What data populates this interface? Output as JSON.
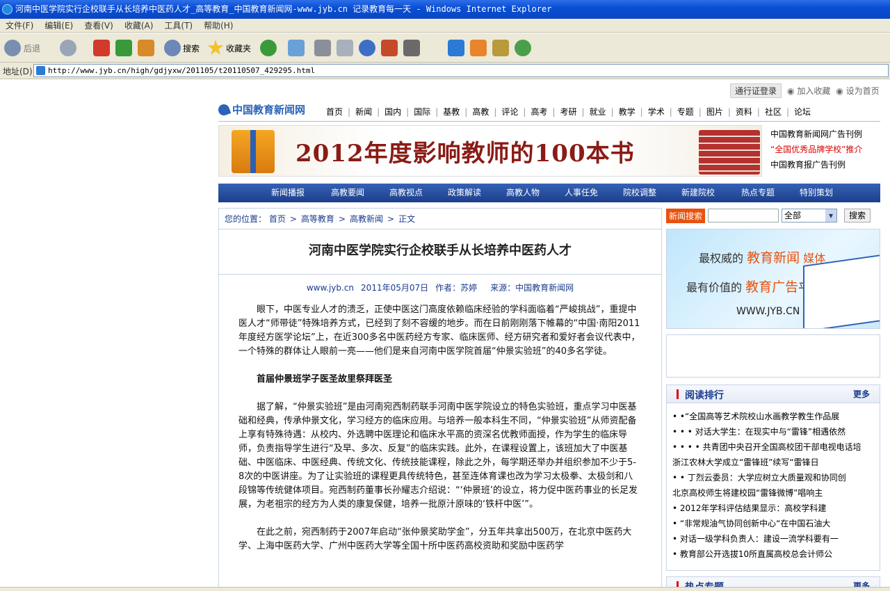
{
  "window": {
    "title": "河南中医学院实行企校联手从长培养中医药人才_高等教育_中国教育新闻网-www.jyb.cn 记录教育每一天 - Windows Internet Explorer"
  },
  "menu": [
    "文件(F)",
    "编辑(E)",
    "查看(V)",
    "收藏(A)",
    "工具(T)",
    "帮助(H)"
  ],
  "toolbar": {
    "back": "后退",
    "search": "搜索",
    "favorites": "收藏夹"
  },
  "address": {
    "label": "地址(D)",
    "url": "http://www.jyb.cn/high/gdjyxw/201105/t20110507_429295.html"
  },
  "site": {
    "login": "通行证登录",
    "add_fav": "加入收藏",
    "set_home": "设为首页",
    "logo": "中国教育新闻网",
    "nav": [
      "首页",
      "新闻",
      "国内",
      "国际",
      "基教",
      "高教",
      "评论",
      "高考",
      "考研",
      "就业",
      "教学",
      "学术",
      "专题",
      "图片",
      "资料",
      "社区",
      "论坛"
    ],
    "banner_text": "2012年度影响教师的100本书",
    "ad_links": [
      "中国教育新闻网广告刊例",
      "“全国优秀品牌学校”推介",
      "中国教育报广告刊例"
    ],
    "subnav": [
      "新闻播报",
      "高教要闻",
      "高教视点",
      "政策解读",
      "高教人物",
      "人事任免",
      "院校调整",
      "新建院校",
      "热点专题",
      "特别策划"
    ]
  },
  "article": {
    "crumb_label": "您的位置：",
    "crumbs": [
      "首页",
      "高等教育",
      "高教新闻",
      "正文"
    ],
    "title": "河南中医学院实行企校联手从长培养中医药人才",
    "meta": {
      "site": "www.jyb.cn",
      "date": "2011年05月07日",
      "author": "作者：苏婷",
      "source": "来源：中国教育新闻网"
    },
    "paragraphs": [
      "眼下，中医专业人才的溃乏，正使中医这门高度依赖临床经验的学科面临着“严峻挑战”，重提中医人才“师带徒”特殊培养方式，已经到了刻不容缓的地步。而在日前刚刚落下帷幕的“中国·南阳2011年度经方医学论坛”上，在近300多名中医药经方专家、临床医师、经方研究者和爱好者会议代表中，一个特殊的群体让人眼前一亮——他们是来自河南中医学院首届“仲景实验班”的40多名学徒。",
      "首届仲景班学子医圣故里祭拜医圣",
      "据了解，“仲景实验班”是由河南宛西制药联手河南中医学院设立的特色实验班，重点学习中医基础和经典，传承仲景文化，学习经方的临床应用。与培养一般本科生不同，“仲景实验班”从师资配备上享有特殊待遇：从校内、外选聘中医理论和临床水平高的资深名优教师面授，作为学生的临床导师，负责指导学生进行“及早、多次、反复”的临床实践。此外，在课程设置上，该班加大了中医基础、中医临床、中医经典、传统文化、传统技能课程，除此之外，每学期还举办并组织参加不少于5-8次的中医讲座。为了让实验班的课程更具传统特色，甚至连体育课也改为学习太极拳、太极剑和八段锦等传统健体项目。宛西制药董事长孙耀志介绍说：“‘仲景班’的设立，将力促中医药事业的长足发展，为老祖宗的经方为人类的康复保健，培养一批原汁原味的‘铁杆中医’”。",
      "在此之前，宛西制药于2007年启动“张仲景奖助学金”，分五年共拿出500万，在北京中医药大学、上海中医药大学、广州中医药大学等全国十所中医药高校资助和奖励中医药学"
    ]
  },
  "sidebar": {
    "search_tag": "新闻搜索",
    "search_select": "全部",
    "search_button": "搜索",
    "ad": {
      "line1_a": "最权威的",
      "line1_b": "教育新闻",
      "line1_c": "媒体",
      "line2_a": "最有价值的",
      "line2_b": "教育广告",
      "line2_c": "平台",
      "line3": "WWW.JYB.CN"
    },
    "rank_title": "阅读排行",
    "more": "更多",
    "rank": [
      "• •“全国高等艺术院校山水画教学教生作品展",
      "• • • 对话大学生：在现实中与“雷锋”相遇依然",
      "• • • • 共青团中央召开全国高校团干部电视电话培",
      "浙江农林大学成立“雷锋班”续写“雷锋日",
      "• • 丁烈云委员：大学应树立大质量观和协同创",
      "北京高校师生将建校园“雷锋微博”唱响主",
      "• 2012年学科评估结果显示：高校学科建",
      "• “非常规油气协同创新中心“在中国石油大",
      "• 对话一级学科负责人：建设一流学科要有一",
      "• 教育部公开选拔10所直属高校总会计师公"
    ],
    "hot_title": "热点专题"
  }
}
